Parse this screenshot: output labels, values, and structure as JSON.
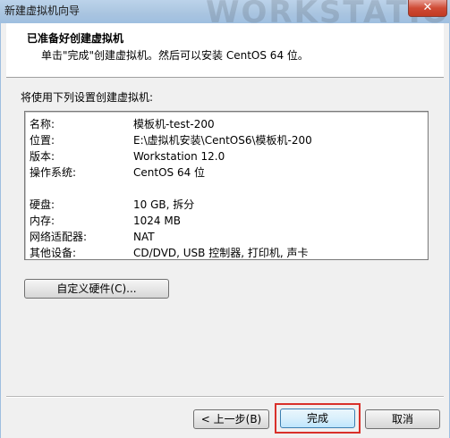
{
  "window": {
    "title": "新建虚拟机向导",
    "brand_watermark": "WORKSTATION",
    "close_label": "✕"
  },
  "header": {
    "title": "已准备好创建虚拟机",
    "subtitle": "单击\"完成\"创建虚拟机。然后可以安装 CentOS 64 位。"
  },
  "intro_text": "将使用下列设置创建虚拟机:",
  "settings": [
    {
      "key": "名称:",
      "value": "模板机-test-200"
    },
    {
      "key": "位置:",
      "value": "E:\\虚拟机安装\\CentOS6\\模板机-200"
    },
    {
      "key": "版本:",
      "value": "Workstation 12.0"
    },
    {
      "key": "操作系统:",
      "value": "CentOS 64 位"
    },
    {
      "key": "硬盘:",
      "value": "10 GB, 拆分"
    },
    {
      "key": "内存:",
      "value": "1024 MB"
    },
    {
      "key": "网络适配器:",
      "value": "NAT"
    },
    {
      "key": "其他设备:",
      "value": "CD/DVD, USB 控制器, 打印机, 声卡"
    }
  ],
  "buttons": {
    "customize": "自定义硬件(C)...",
    "back": "< 上一步(B)",
    "finish": "完成",
    "cancel": "取消"
  },
  "colors": {
    "highlight_outline": "#d9302a"
  }
}
